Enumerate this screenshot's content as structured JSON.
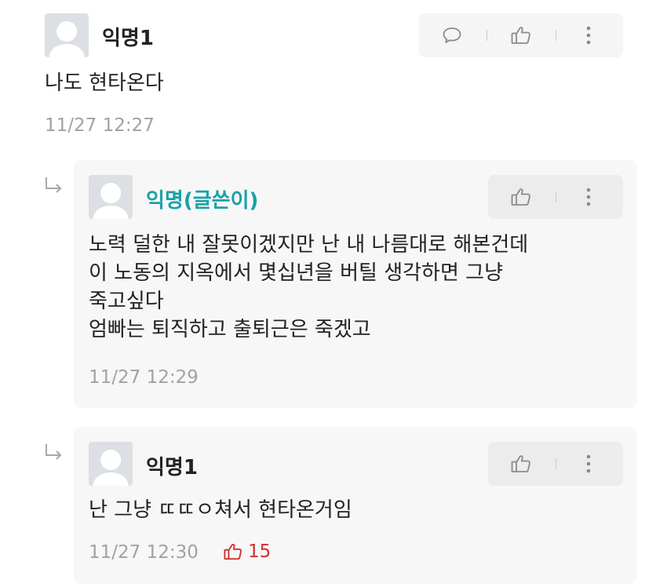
{
  "colors": {
    "author": "#1aa1a7",
    "like": "#d0312d",
    "meta": "#a2a2a2"
  },
  "comments": [
    {
      "name": "익명1",
      "text": "나도 현타온다",
      "time": "11/27 12:27",
      "actions": [
        "comment-icon",
        "thumbs-up-icon",
        "more-icon"
      ]
    },
    {
      "name": "익명(글쓴이)",
      "is_author": true,
      "lines": [
        "노력 덜한 내 잘못이겠지만 난 내 나름대로 해본건데",
        "이 노동의 지옥에서 몇십년을 버틸 생각하면 그냥",
        "죽고싶다",
        "엄빠는 퇴직하고 출퇴근은 죽겠고"
      ],
      "time": "11/27 12:29",
      "actions": [
        "thumbs-up-icon",
        "more-icon"
      ]
    },
    {
      "name": "익명1",
      "text": "난 그냥 ㄸㄸㅇ쳐서 현타온거임",
      "time": "11/27 12:30",
      "like_count": "15",
      "actions": [
        "thumbs-up-icon",
        "more-icon"
      ]
    }
  ]
}
